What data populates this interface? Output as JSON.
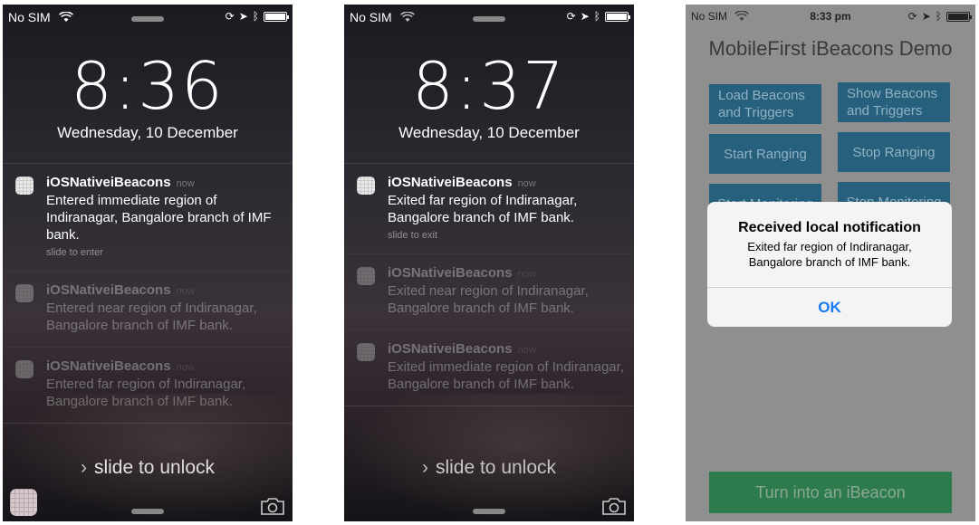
{
  "screens": [
    {
      "status": {
        "carrier": "No SIM"
      },
      "clock": "8:36",
      "date": "Wednesday, 10 December",
      "notifications": [
        {
          "app": "iOSNativeiBeacons",
          "time": "now",
          "message": "Entered immediate region of Indiranagar, Bangalore branch of IMF bank.",
          "hint": "slide to enter"
        },
        {
          "app": "iOSNativeiBeacons",
          "time": "now",
          "message": "Entered near region of Indiranagar, Bangalore branch of IMF bank."
        },
        {
          "app": "iOSNativeiBeacons",
          "time": "now",
          "message": "Entered far region of Indiranagar, Bangalore branch of IMF bank."
        }
      ],
      "unlock_text": "slide to unlock"
    },
    {
      "status": {
        "carrier": "No SIM"
      },
      "clock": "8:37",
      "date": "Wednesday, 10 December",
      "notifications": [
        {
          "app": "iOSNativeiBeacons",
          "time": "now",
          "message": "Exited far region of Indiranagar, Bangalore branch of IMF bank.",
          "hint": "slide to exit"
        },
        {
          "app": "iOSNativeiBeacons",
          "time": "now",
          "message": "Exited near region of Indiranagar, Bangalore branch of IMF bank."
        },
        {
          "app": "iOSNativeiBeacons",
          "time": "now",
          "message": "Exited immediate region of Indiranagar, Bangalore branch of IMF bank."
        }
      ],
      "unlock_text": "slide to unlock"
    },
    {
      "status": {
        "carrier": "No SIM",
        "time": "8:33 pm"
      },
      "title": "MobileFirst iBeacons Demo",
      "buttons": {
        "load": "Load Beacons and Triggers",
        "show": "Show Beacons and Triggers",
        "start_ranging": "Start Ranging",
        "stop_ranging": "Stop Ranging",
        "start_monitoring": "Start Monitoring",
        "stop_monitoring": "Stop Monitoring",
        "turn_into_beacon": "Turn into an iBeacon"
      },
      "alert": {
        "title": "Received local notification",
        "message": "Exited far region of Indiranagar, Bangalore branch of IMF bank.",
        "ok": "OK"
      }
    }
  ],
  "colors": {
    "button_blue": "#27607c",
    "button_green": "#2d7a4d",
    "alert_link": "#1a7af0"
  },
  "icons": [
    "wifi-icon",
    "orientation-lock-icon",
    "location-icon",
    "bluetooth-icon",
    "battery-icon",
    "camera-icon",
    "app-icon",
    "chevron-right-icon"
  ]
}
